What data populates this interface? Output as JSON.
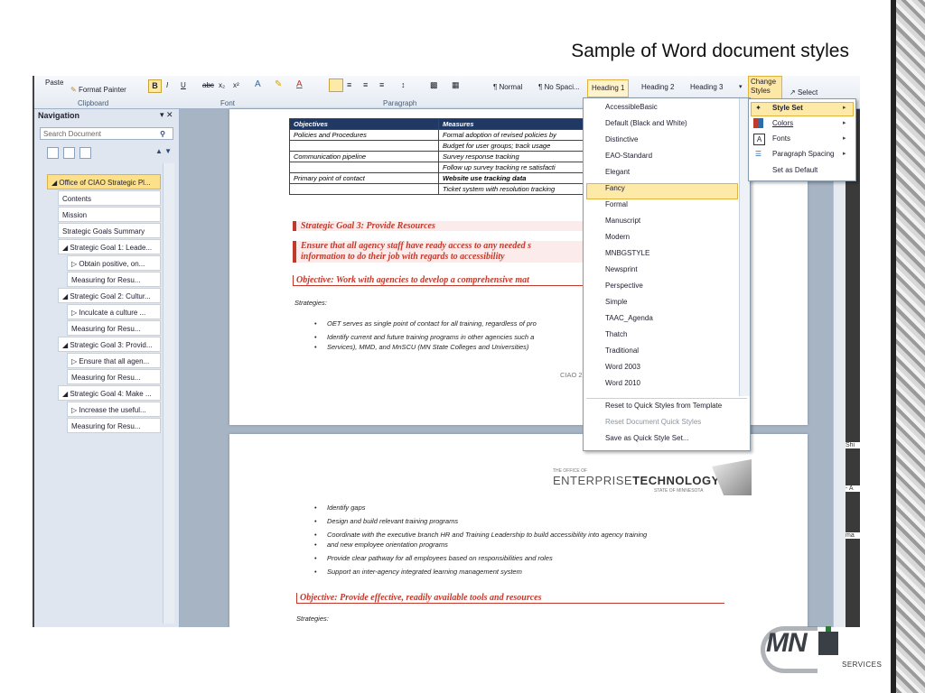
{
  "slide": {
    "title": "Sample of  Word document styles"
  },
  "ribbon": {
    "paste": "Paste",
    "format_painter": "Format Painter",
    "groups": [
      "Clipboard",
      "Font",
      "Paragraph"
    ],
    "font_buttons": [
      "B",
      "I",
      "U",
      "abc",
      "x₂",
      "x²"
    ],
    "styles": [
      "¶ Normal",
      "¶ No Spaci...",
      "Heading 1",
      "Heading 2",
      "Heading 3"
    ],
    "change_styles": "Change Styles",
    "select": "Select"
  },
  "navigation": {
    "title": "Navigation",
    "close": "▾ ✕",
    "search_placeholder": "Search Document",
    "items": [
      {
        "label": "◢ Office of CIAO Strategic Pl...",
        "level": 0,
        "selected": true
      },
      {
        "label": "Contents",
        "level": 1
      },
      {
        "label": "Mission",
        "level": 1
      },
      {
        "label": "Strategic Goals Summary",
        "level": 1
      },
      {
        "label": "◢ Strategic Goal 1: Leade...",
        "level": 1
      },
      {
        "label": "▷ Obtain positive, on...",
        "level": 2
      },
      {
        "label": "Measuring for Resu...",
        "level": 2
      },
      {
        "label": "◢ Strategic Goal 2: Cultur...",
        "level": 1
      },
      {
        "label": "▷ Inculcate a culture ...",
        "level": 2
      },
      {
        "label": "Measuring for Resu...",
        "level": 2
      },
      {
        "label": "◢ Strategic Goal 3: Provid...",
        "level": 1
      },
      {
        "label": "▷ Ensure that all agen...",
        "level": 2
      },
      {
        "label": "Measuring for Resu...",
        "level": 2
      },
      {
        "label": "◢ Strategic Goal 4: Make ...",
        "level": 1
      },
      {
        "label": "▷ Increase the useful...",
        "level": 2
      },
      {
        "label": "Measuring for Resu...",
        "level": 2
      }
    ]
  },
  "doc": {
    "table": {
      "headers": [
        "Objectives",
        "Measures"
      ],
      "rows": [
        [
          "Policies and Procedures",
          "Formal adoption of revised policies by"
        ],
        [
          "",
          "Budget for user groups; track usage"
        ],
        [
          "Communication pipeline",
          "Survey response tracking"
        ],
        [
          "",
          "Follow up survey tracking re satisfacti"
        ],
        [
          "Primary point of contact",
          "Website use tracking data"
        ],
        [
          "",
          "Ticket system with resolution tracking"
        ]
      ]
    },
    "goal3": "Strategic Goal 3: Provide Resources",
    "ensure": "Ensure that all agency staff have ready access to any needed s",
    "ensure2": "information to do their job with regards to accessibility",
    "objective1": "Objective: Work with agencies to develop a comprehensive mat",
    "strategies": "Strategies:",
    "bullets1": [
      "OET serves as single point of contact for all training, regardless of pro",
      "Identify current and future training programs in other agencies such a",
      "Services),  MMD, and MnSCU (MN State Colleges and Universities)"
    ],
    "footer": "CIAO 2",
    "logo_small": "THE OFFICE OF",
    "logo_main_a": "ENTERPRISE",
    "logo_main_b": "TECHNOLOGY",
    "logo_sub": "STATE OF MINNESOTA",
    "bullets2": [
      "Identify gaps",
      "Design and build relevant training programs",
      "Coordinate with the executive branch HR and Training Leadership to build accessibility into agency training",
      "and new employee orientation programs",
      "Provide clear pathway for all employees based on responsibilities and roles",
      "Support an inter-agency integrated learning management system"
    ],
    "objective2": "Objective:  Provide effective, readily available tools and resources",
    "strategies2": "Strategies:"
  },
  "style_set_menu": {
    "items": [
      "AccessibleBasic",
      "Default (Black and White)",
      "Distinctive",
      "EAO-Standard",
      "Elegant",
      "Fancy",
      "Formal",
      "Manuscript",
      "Modern",
      "MNBGSTYLE",
      "Newsprint",
      "Perspective",
      "Simple",
      "TAAC_Agenda",
      "Thatch",
      "Traditional",
      "Word 2003",
      "Word 2010"
    ],
    "highlighted": "Fancy",
    "actions": [
      "Reset to Quick Styles from Template",
      "Reset Document Quick Styles",
      "Save as Quick Style Set..."
    ]
  },
  "change_styles_menu": {
    "items": [
      "Style Set",
      "Colors",
      "Fonts",
      "Paragraph Spacing",
      "Set as Default"
    ]
  },
  "branding": {
    "mark": "MN",
    "services": "SERVICES"
  },
  "right_fragments": [
    "Shi",
    "- A",
    "ma"
  ]
}
